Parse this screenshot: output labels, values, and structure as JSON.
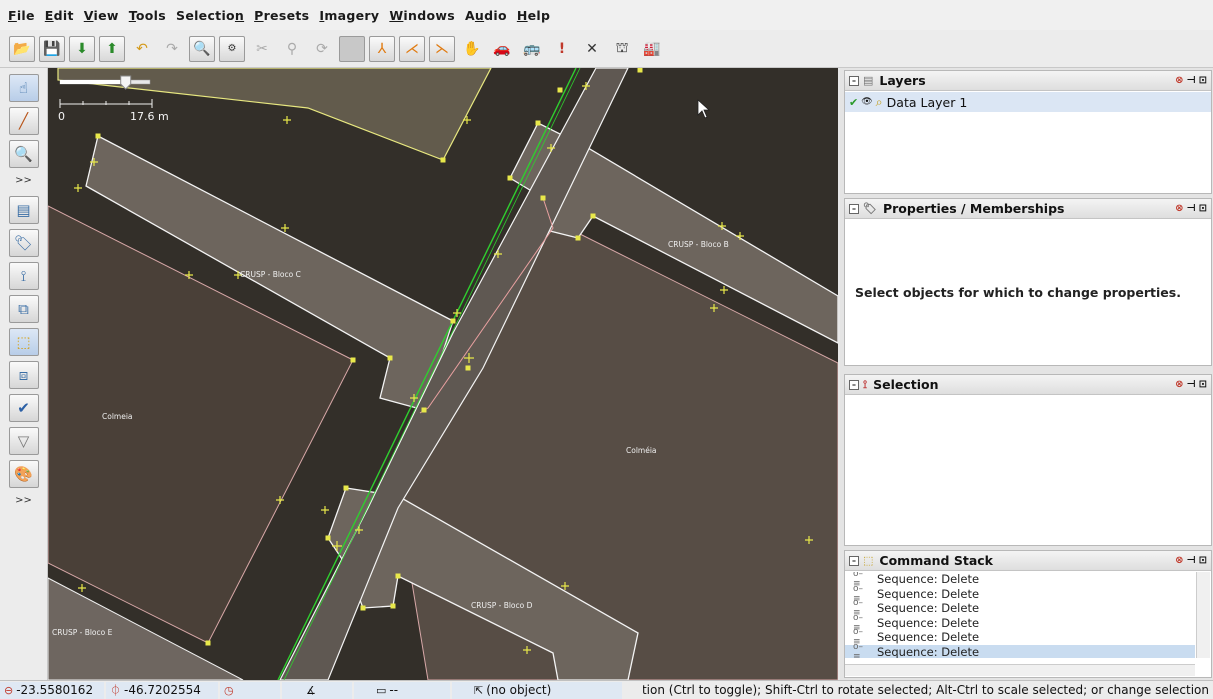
{
  "menu": [
    {
      "label": "File",
      "u": "F",
      "rest": "ile"
    },
    {
      "label": "Edit",
      "u": "E",
      "rest": "dit"
    },
    {
      "label": "View",
      "u": "V",
      "rest": "iew"
    },
    {
      "label": "Tools",
      "u": "T",
      "rest": "ools"
    },
    {
      "label": "Selection",
      "pre": "Selectio",
      "u": "n",
      "rest": ""
    },
    {
      "label": "Presets",
      "u": "P",
      "rest": "resets"
    },
    {
      "label": "Imagery",
      "u": "I",
      "rest": "magery"
    },
    {
      "label": "Windows",
      "u": "W",
      "rest": "indows"
    },
    {
      "label": "Audio",
      "pre": "A",
      "u": "u",
      "rest": "dio"
    },
    {
      "label": "Help",
      "u": "H",
      "rest": "elp"
    }
  ],
  "scale": {
    "start": "0",
    "end": "17.6 m",
    "zoom_level": 0.73
  },
  "map_labels": {
    "bloco_c": "CRUSP - Bloco C",
    "bloco_b": "CRUSP - Bloco B",
    "bloco_d": "CRUSP - Bloco D",
    "bloco_e": "CRUSP - Bloco E",
    "colmeia_left": "Colmeia",
    "colmeia_right": "Colméia"
  },
  "panels": {
    "layers": {
      "title": "Layers",
      "layer_name": "Data Layer 1"
    },
    "properties": {
      "title": "Properties / Memberships",
      "message": "Select objects for which to change properties."
    },
    "selection": {
      "title": "Selection"
    },
    "command_stack": {
      "title": "Command Stack",
      "items": [
        "Sequence: Delete",
        "Sequence: Delete",
        "Sequence: Delete",
        "Sequence: Delete",
        "Sequence: Delete",
        "Sequence: Delete"
      ]
    }
  },
  "status": {
    "lat": "-23.5580162",
    "lon": "-46.7202554",
    "length": "--",
    "object": "(no object)",
    "help": "ection (Ctrl to toggle); Shift-Ctrl to rotate selected; Alt-Ctrl to scale selected; or change selection"
  },
  "colors": {
    "map_bg": "#332f29",
    "way_green": "#2fcf2f",
    "node_yellow": "#e8e84a",
    "building_fill": "#6a625a"
  }
}
